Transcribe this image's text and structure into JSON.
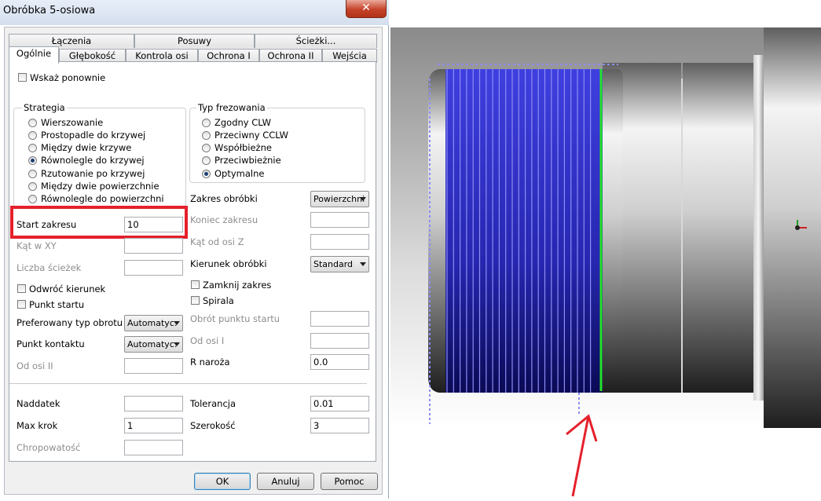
{
  "window": {
    "title": "Obróbka 5-osiowa",
    "close_glyph": "✕"
  },
  "tabs_row1": [
    "Łączenia",
    "Posuwy",
    "Ścieżki..."
  ],
  "tabs_row2": [
    "Ogólnie",
    "Głębokość",
    "Kontrola osi",
    "Ochrona I",
    "Ochrona II",
    "Wejścia"
  ],
  "active_tab": "Ogólnie",
  "show_again": {
    "label": "Wskaż ponownie",
    "checked": false
  },
  "strategy": {
    "title": "Strategia",
    "options": [
      "Wierszowanie",
      "Prostopadle do krzywej",
      "Między dwie krzywe",
      "Równolegle do krzywej",
      "Rzutowanie po krzywej",
      "Między dwie powierzchnie",
      "Równolegle do powierzchni"
    ],
    "selected_index": 3
  },
  "milling_type": {
    "title": "Typ frezowania",
    "options": [
      "Zgodny CLW",
      "Przeciwny CCLW",
      "Współbieżne",
      "Przeciwbieżnie",
      "Optymalne"
    ],
    "selected_index": 4
  },
  "left_fields": {
    "start_zakresu": {
      "label": "Start zakresu",
      "value": "10"
    },
    "kat_w_xy": {
      "label": "Kąt w XY",
      "value": ""
    },
    "liczba_sciezek": {
      "label": "Liczba ścieżek",
      "value": ""
    },
    "odwroc_kierunek": {
      "label": "Odwróć kierunek",
      "checked": false
    },
    "punkt_startu": {
      "label": "Punkt startu",
      "checked": false
    },
    "preferowany_typ_obrotu": {
      "label": "Preferowany typ obrotu",
      "value": "Automatyc:"
    },
    "punkt_kontaktu": {
      "label": "Punkt kontaktu",
      "value": "Automatyc:"
    },
    "od_osi_ii": {
      "label": "Od osi II",
      "value": ""
    }
  },
  "right_fields": {
    "zakres_obrobki": {
      "label": "Zakres obróbki",
      "value": "Powierzchni"
    },
    "koniec_zakresu": {
      "label": "Koniec zakresu",
      "value": ""
    },
    "kat_od_osi_z": {
      "label": "Kąt od osi Z",
      "value": ""
    },
    "kierunek_obrobki": {
      "label": "Kierunek obróbki",
      "value": "Standard"
    },
    "zamknij_zakres": {
      "label": "Zamknij zakres",
      "checked": false
    },
    "spirala": {
      "label": "Spirala",
      "checked": false
    },
    "obrot_punktu_startu": {
      "label": "Obrót punktu startu",
      "value": ""
    },
    "od_osi_i": {
      "label": "Od osi I",
      "value": ""
    },
    "r_naroza": {
      "label": "R naroża",
      "value": "0.0"
    }
  },
  "bottom_fields": {
    "naddatek": {
      "label": "Naddatek",
      "value": ""
    },
    "max_krok": {
      "label": "Max krok",
      "value": "1"
    },
    "chropowatosc": {
      "label": "Chropowatość",
      "value": ""
    },
    "tolerancja": {
      "label": "Tolerancja",
      "value": "0.01"
    },
    "szerokosc": {
      "label": "Szerokość",
      "value": "3"
    }
  },
  "buttons": {
    "ok": "OK",
    "cancel": "Anuluj",
    "help": "Pomoc"
  },
  "colors": {
    "highlight_red": "#e5202b",
    "toolpath_blue": "#3a35d8",
    "start_line_green": "#27e327"
  }
}
